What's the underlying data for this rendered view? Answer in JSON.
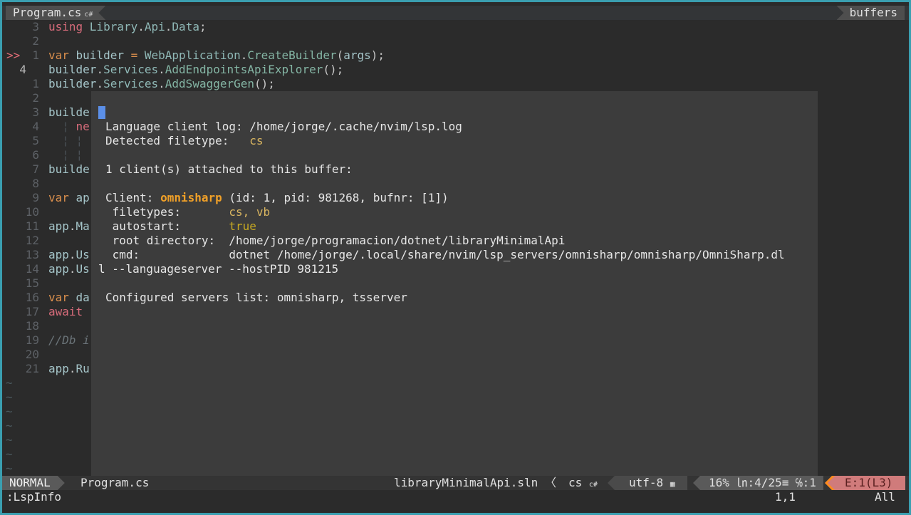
{
  "tabline": {
    "active_tab": "Program.cs",
    "active_tab_icon": "csharp-icon",
    "right_tag": "buffers"
  },
  "editor": {
    "sign": ">>",
    "lines": [
      {
        "num": "3",
        "segs": [
          [
            "kw2",
            "using "
          ],
          [
            "ty",
            "Library"
          ],
          [
            "pu",
            "."
          ],
          [
            "ty",
            "Api"
          ],
          [
            "pu",
            "."
          ],
          [
            "ty",
            "Data"
          ],
          [
            "pu",
            ";"
          ]
        ]
      },
      {
        "num": "2",
        "segs": []
      },
      {
        "num": "1",
        "sign": true,
        "segs": [
          [
            "kw",
            "var "
          ],
          [
            "id",
            "builder "
          ],
          [
            "op",
            "= "
          ],
          [
            "ty",
            "WebApplication"
          ],
          [
            "pu",
            "."
          ],
          [
            "fn",
            "CreateBuilder"
          ],
          [
            "pu",
            "("
          ],
          [
            "id",
            "args"
          ],
          [
            "pu",
            ");"
          ]
        ]
      },
      {
        "num": "4",
        "current": true,
        "segs": [
          [
            "id",
            "builder"
          ],
          [
            "pu",
            "."
          ],
          [
            "ty",
            "Services"
          ],
          [
            "pu",
            "."
          ],
          [
            "fn",
            "AddEndpointsApiExplorer"
          ],
          [
            "pu",
            "();"
          ]
        ]
      },
      {
        "num": "1",
        "segs": [
          [
            "id",
            "builder"
          ],
          [
            "pu",
            "."
          ],
          [
            "ty",
            "Services"
          ],
          [
            "pu",
            "."
          ],
          [
            "fn",
            "AddSwaggerGen"
          ],
          [
            "pu",
            "();"
          ]
        ]
      },
      {
        "num": "2",
        "segs": []
      },
      {
        "num": "3",
        "segs": [
          [
            "id",
            "builde"
          ]
        ]
      },
      {
        "num": "4",
        "segs": [
          [
            "indent",
            "  ¦ "
          ],
          [
            "kw2",
            "ne"
          ]
        ]
      },
      {
        "num": "5",
        "segs": [
          [
            "indent",
            "  ¦ ¦"
          ]
        ]
      },
      {
        "num": "6",
        "segs": [
          [
            "indent",
            "  ¦ ¦"
          ]
        ]
      },
      {
        "num": "7",
        "segs": [
          [
            "id",
            "builde"
          ]
        ]
      },
      {
        "num": "8",
        "segs": []
      },
      {
        "num": "9",
        "segs": [
          [
            "kw",
            "var "
          ],
          [
            "id",
            "ap"
          ]
        ]
      },
      {
        "num": "10",
        "segs": []
      },
      {
        "num": "11",
        "segs": [
          [
            "id",
            "app"
          ],
          [
            "pu",
            "."
          ],
          [
            "id",
            "Ma"
          ]
        ]
      },
      {
        "num": "12",
        "segs": []
      },
      {
        "num": "13",
        "segs": [
          [
            "id",
            "app"
          ],
          [
            "pu",
            "."
          ],
          [
            "id",
            "Us"
          ]
        ]
      },
      {
        "num": "14",
        "segs": [
          [
            "id",
            "app"
          ],
          [
            "pu",
            "."
          ],
          [
            "id",
            "Us"
          ]
        ]
      },
      {
        "num": "15",
        "segs": []
      },
      {
        "num": "16",
        "segs": [
          [
            "kw",
            "var "
          ],
          [
            "id",
            "da"
          ]
        ]
      },
      {
        "num": "17",
        "segs": [
          [
            "kw2",
            "await "
          ]
        ]
      },
      {
        "num": "18",
        "segs": []
      },
      {
        "num": "19",
        "segs": [
          [
            "cmt",
            "//Db i"
          ]
        ]
      },
      {
        "num": "20",
        "segs": []
      },
      {
        "num": "21",
        "segs": [
          [
            "id",
            "app"
          ],
          [
            "pu",
            "."
          ],
          [
            "id",
            "Ru"
          ]
        ]
      }
    ],
    "tilde_count": 7,
    "tilde": "~"
  },
  "lspinfo": {
    "log_label": "Language client log: ",
    "log_path": "/home/jorge/.cache/nvim/lsp.log",
    "filetype_label": "Detected filetype:   ",
    "filetype": "cs",
    "attached": "1 client(s) attached to this buffer:",
    "client_label": "Client: ",
    "client_name": "omnisharp",
    "client_meta": " (id: 1, pid: 981268, bufnr: [1])",
    "filetypes_label": " filetypes:       ",
    "filetypes": "cs, vb",
    "autostart_label": " autostart:       ",
    "autostart": "true",
    "root_label": " root directory:  ",
    "root": "/home/jorge/programacion/dotnet/libraryMinimalApi",
    "cmd_label": " cmd:             ",
    "cmd": "dotnet /home/jorge/.local/share/nvim/lsp_servers/omnisharp/omnisharp/OmniSharp.dl",
    "cmd_wrap": "l --languageserver --hostPID 981215",
    "configured": "Configured servers list: omnisharp, tsserver"
  },
  "statusline": {
    "mode": "NORMAL",
    "file": "Program.cs",
    "solution": "libraryMinimalApi.sln",
    "separator": "〈",
    "filetype": "cs",
    "encoding": "utf-8",
    "os_icon": "windows-icon",
    "position": "16% ㏑:4/25≡ ℅:1",
    "errors": "E:1(L3)"
  },
  "cmdline": {
    "command": ":LspInfo",
    "cursor_pos": "1,1",
    "scroll": "All"
  }
}
